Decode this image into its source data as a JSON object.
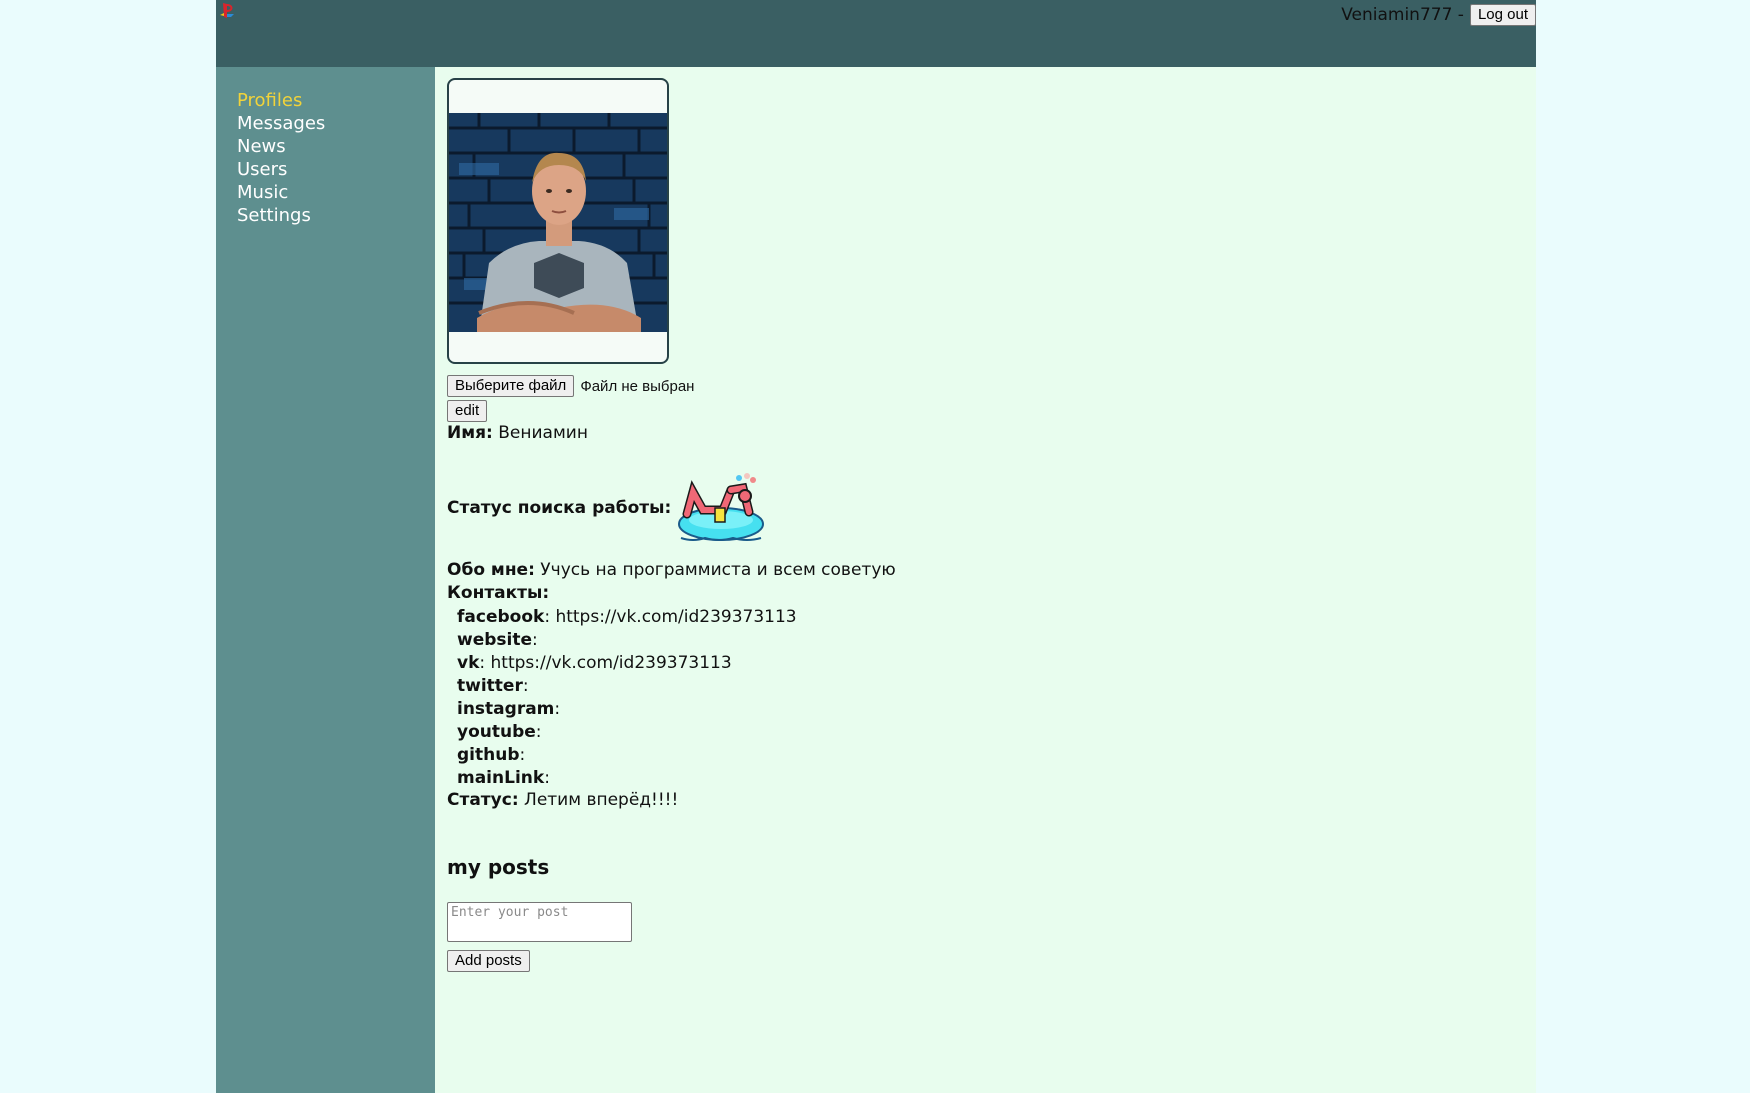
{
  "header": {
    "user_login": "Veniamin777 -",
    "logout_label": "Log out"
  },
  "sidebar": {
    "items": [
      {
        "label": "Profiles",
        "active": true
      },
      {
        "label": "Messages"
      },
      {
        "label": "News"
      },
      {
        "label": "Users"
      },
      {
        "label": "Music"
      },
      {
        "label": "Settings"
      }
    ]
  },
  "profile": {
    "file_button_label": "Выберите файл",
    "file_status": "Файл не выбран",
    "edit_label": "edit",
    "name_label": "Имя:",
    "name_value": "Вениамин",
    "job_label": "Статус поиска работы:",
    "about_label": "Обо мне:",
    "about_value": "Учусь на программиста и всем советую",
    "contacts_label": "Контакты:",
    "contacts": [
      {
        "name": "facebook",
        "value": "https://vk.com/id239373113"
      },
      {
        "name": "website",
        "value": ""
      },
      {
        "name": "vk",
        "value": "https://vk.com/id239373113"
      },
      {
        "name": "twitter",
        "value": ""
      },
      {
        "name": "instagram",
        "value": ""
      },
      {
        "name": "youtube",
        "value": ""
      },
      {
        "name": "github",
        "value": ""
      },
      {
        "name": "mainLink",
        "value": ""
      }
    ],
    "status_label": "Статус:",
    "status_value": "Летим вперёд!!!!"
  },
  "posts": {
    "title": "my posts",
    "placeholder": "Enter your post",
    "add_label": "Add posts"
  },
  "colors": {
    "header": "#3a5f63",
    "sidebar": "#5e8f8f",
    "content": "#e8fdee",
    "active_nav": "#f1d33a"
  }
}
